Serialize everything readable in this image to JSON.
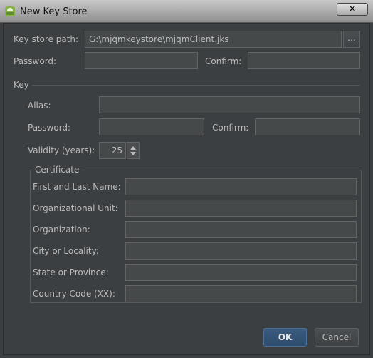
{
  "window": {
    "title": "New Key Store",
    "close_label": "✕"
  },
  "keystore": {
    "path_label": "Key store path:",
    "path_value": "G:\\mjqmkeystore\\mjqmClient.jks",
    "browse_label": "...",
    "password_label": "Password:",
    "confirm_label": "Confirm:"
  },
  "key": {
    "section_label": "Key",
    "alias_label": "Alias:",
    "password_label": "Password:",
    "confirm_label": "Confirm:",
    "validity_label": "Validity (years):",
    "validity_value": "25"
  },
  "certificate": {
    "section_label": "Certificate",
    "fields": [
      {
        "label": "First and Last Name:",
        "value": ""
      },
      {
        "label": "Organizational Unit:",
        "value": ""
      },
      {
        "label": "Organization:",
        "value": ""
      },
      {
        "label": "City or Locality:",
        "value": ""
      },
      {
        "label": "State or Province:",
        "value": ""
      },
      {
        "label": "Country Code (XX):",
        "value": ""
      }
    ]
  },
  "buttons": {
    "ok": "OK",
    "cancel": "Cancel"
  }
}
